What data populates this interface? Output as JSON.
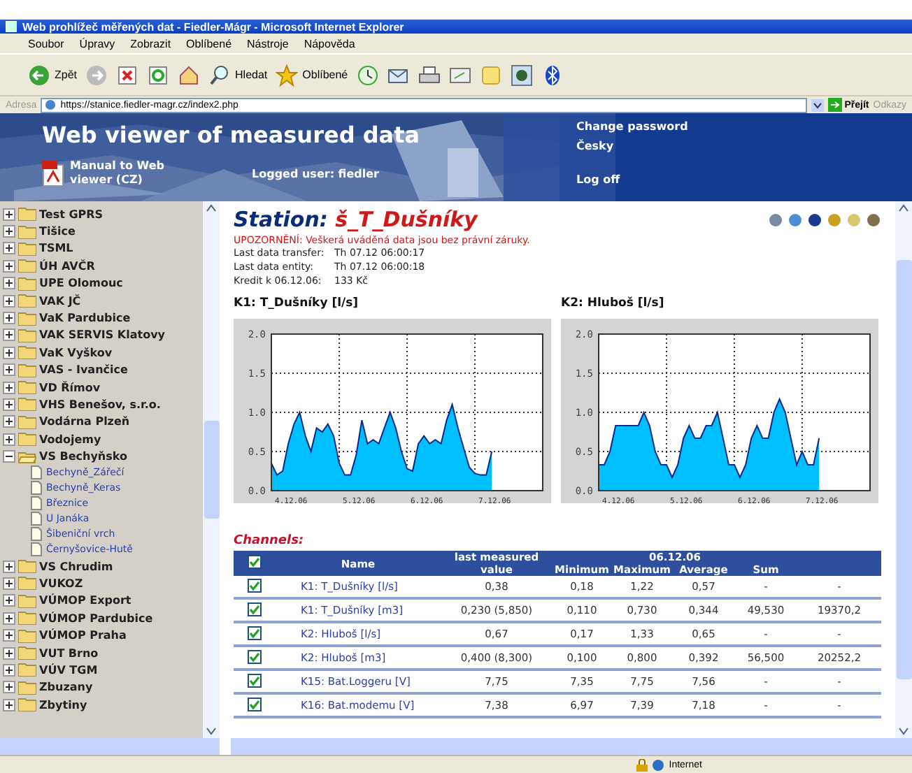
{
  "window": {
    "title": "Web prohlížeč měřených dat - Fiedler-Mágr - Microsoft Internet Explorer"
  },
  "menu": [
    "Soubor",
    "Úpravy",
    "Zobrazit",
    "Oblíbené",
    "Nástroje",
    "Nápověda"
  ],
  "toolbar": {
    "back": "Zpět",
    "search": "Hledat",
    "favorites": "Oblíbené"
  },
  "address_bar": {
    "label": "Adresa",
    "value": "https://stanice.fiedler-magr.cz/index2.php",
    "go": "Přejít",
    "links": "Odkazy"
  },
  "header": {
    "title": "Web viewer of measured data",
    "manual": "Manual to Web viewer (CZ)",
    "logged_user": "Logged user: fiedler",
    "links": [
      "Change password",
      "Česky",
      "Log off"
    ]
  },
  "sidebar": {
    "items": [
      {
        "label": "Test GPRS",
        "expanded": false
      },
      {
        "label": "Tišice",
        "expanded": false
      },
      {
        "label": "TSML",
        "expanded": false
      },
      {
        "label": "ÚH AVČR",
        "expanded": false
      },
      {
        "label": "UPE Olomouc",
        "expanded": false
      },
      {
        "label": "VAK JČ",
        "expanded": false
      },
      {
        "label": "VaK Pardubice",
        "expanded": false
      },
      {
        "label": "VAK SERVIS Klatovy",
        "expanded": false
      },
      {
        "label": "VaK Vyškov",
        "expanded": false
      },
      {
        "label": "VAS - Ivančice",
        "expanded": false
      },
      {
        "label": "VD Římov",
        "expanded": false
      },
      {
        "label": "VHS Benešov, s.r.o.",
        "expanded": false
      },
      {
        "label": "Vodárna Plzeň",
        "expanded": false
      },
      {
        "label": "Vodojemy",
        "expanded": false
      },
      {
        "label": "VS Bechyňsko",
        "expanded": true,
        "children": [
          {
            "label": "Bechyně_Zářečí"
          },
          {
            "label": "Bechyně_Keras"
          },
          {
            "label": "Březnice"
          },
          {
            "label": "U Janáka"
          },
          {
            "label": "Šibeniční vrch"
          },
          {
            "label": "Černyšovice-Hutě"
          }
        ]
      },
      {
        "label": "VS Chrudim",
        "expanded": false
      },
      {
        "label": "VUKOZ",
        "expanded": false
      },
      {
        "label": "VÚMOP Export",
        "expanded": false
      },
      {
        "label": "VÚMOP Pardubice",
        "expanded": false
      },
      {
        "label": "VÚMOP Praha",
        "expanded": false
      },
      {
        "label": "VUT Brno",
        "expanded": false
      },
      {
        "label": "VÚV TGM",
        "expanded": false
      },
      {
        "label": "Zbuzany",
        "expanded": false
      },
      {
        "label": "Zbytiny",
        "expanded": false
      }
    ]
  },
  "station": {
    "label": "Station:",
    "name": "š_T_Dušníky",
    "warning": "UPOZORNĚNÍ: Veškerá uváděná data jsou bez právní záruky.",
    "info": [
      {
        "label": "Last data transfer:",
        "value": "Th 07.12 06:00:17"
      },
      {
        "label": "Last data entity:",
        "value": "Th 07.12 06:00:18"
      },
      {
        "label": "Kredit k 06.12.06:",
        "value": "133 Kč"
      }
    ]
  },
  "charts": [
    {
      "chart_data": {
        "type": "area",
        "title": "K1: T_Dušníky [l/s]",
        "grid": true,
        "categories": [
          null,
          null,
          null,
          "4.12.06",
          null,
          null,
          null,
          null,
          null,
          null,
          null,
          null,
          null,
          null,
          null,
          "5.12.06",
          null,
          null,
          null,
          null,
          null,
          null,
          null,
          null,
          null,
          null,
          null,
          "6.12.06",
          null,
          null,
          null,
          null,
          null,
          null,
          null,
          null,
          null,
          null,
          null,
          "7.12.06"
        ],
        "series": [
          {
            "color": "#00bfff",
            "values": [
              0.35,
              0.2,
              0.25,
              0.6,
              0.85,
              1.0,
              0.7,
              0.5,
              0.8,
              0.75,
              0.85,
              0.7,
              0.35,
              0.2,
              0.2,
              0.45,
              0.9,
              0.6,
              0.65,
              0.6,
              0.8,
              1.0,
              0.8,
              0.5,
              0.28,
              0.25,
              0.6,
              0.7,
              0.6,
              0.65,
              0.6,
              0.9,
              1.1,
              0.8,
              0.55,
              0.3,
              0.22,
              0.2,
              0.2,
              0.5
            ]
          }
        ],
        "ylim": [
          0,
          2
        ],
        "yticks": [
          {
            "value": 0,
            "label": "0.0"
          },
          {
            "value": 0.5,
            "label": "0.5"
          },
          {
            "value": 1,
            "label": "1.0"
          },
          {
            "value": 1.5,
            "label": "1.5"
          },
          {
            "value": 2,
            "label": "2.0"
          }
        ]
      }
    },
    {
      "chart_data": {
        "type": "area",
        "title": "K2: Hluboš [l/s]",
        "grid": true,
        "categories": [
          null,
          null,
          null,
          "4.12.06",
          null,
          null,
          null,
          null,
          null,
          null,
          null,
          null,
          null,
          null,
          null,
          "5.12.06",
          null,
          null,
          null,
          null,
          null,
          null,
          null,
          null,
          null,
          null,
          null,
          "6.12.06",
          null,
          null,
          null,
          null,
          null,
          null,
          null,
          null,
          null,
          null,
          null,
          "7.12.06"
        ],
        "series": [
          {
            "color": "#00bfff",
            "values": [
              0.33,
              0.33,
              0.5,
              0.83,
              0.83,
              0.83,
              0.83,
              0.83,
              1.0,
              0.83,
              0.5,
              0.33,
              0.33,
              0.17,
              0.33,
              0.67,
              0.83,
              0.67,
              0.67,
              0.83,
              0.83,
              1.0,
              0.67,
              0.33,
              0.33,
              0.17,
              0.33,
              0.67,
              0.83,
              0.67,
              0.67,
              1.0,
              1.17,
              1.0,
              0.67,
              0.33,
              0.5,
              0.33,
              0.33,
              0.67
            ]
          }
        ],
        "ylim": [
          0,
          2
        ],
        "yticks": [
          {
            "value": 0,
            "label": "0.0"
          },
          {
            "value": 0.5,
            "label": "0.5"
          },
          {
            "value": 1,
            "label": "1.0"
          },
          {
            "value": 1.5,
            "label": "1.5"
          },
          {
            "value": 2,
            "label": "2.0"
          }
        ]
      }
    }
  ],
  "channels": {
    "title": "Channels:",
    "header_checked": true,
    "columns": [
      "Name",
      "last measured value"
    ],
    "date": "06.12.06",
    "stats_columns": [
      "Minimum",
      "Maximum",
      "Average",
      "Sum"
    ],
    "rows": [
      {
        "checked": true,
        "cells": [
          "K1: T_Dušníky [l/s]",
          "0,38",
          "0,18",
          "1,22",
          "0,57",
          "-",
          "-"
        ]
      },
      {
        "checked": true,
        "cells": [
          "K1: T_Dušníky [m3]",
          "0,230 (5,850)",
          "0,110",
          "0,730",
          "0,344",
          "49,530",
          "19370,2"
        ]
      },
      {
        "checked": true,
        "cells": [
          "K2: Hluboš [l/s]",
          "0,67",
          "0,17",
          "1,33",
          "0,65",
          "-",
          "-"
        ]
      },
      {
        "checked": true,
        "cells": [
          "K2: Hluboš [m3]",
          "0,400 (8,300)",
          "0,100",
          "0,800",
          "0,392",
          "56,500",
          "20252,2"
        ]
      },
      {
        "checked": true,
        "cells": [
          "K15: Bat.Loggeru [V]",
          "7,75",
          "7,35",
          "7,75",
          "7,56",
          "-",
          "-"
        ]
      },
      {
        "checked": true,
        "cells": [
          "K16: Bat.modemu [V]",
          "7,38",
          "6,97",
          "7,39",
          "7,18",
          "-",
          "-"
        ]
      }
    ]
  },
  "status_bar": {
    "zone": "Internet"
  }
}
